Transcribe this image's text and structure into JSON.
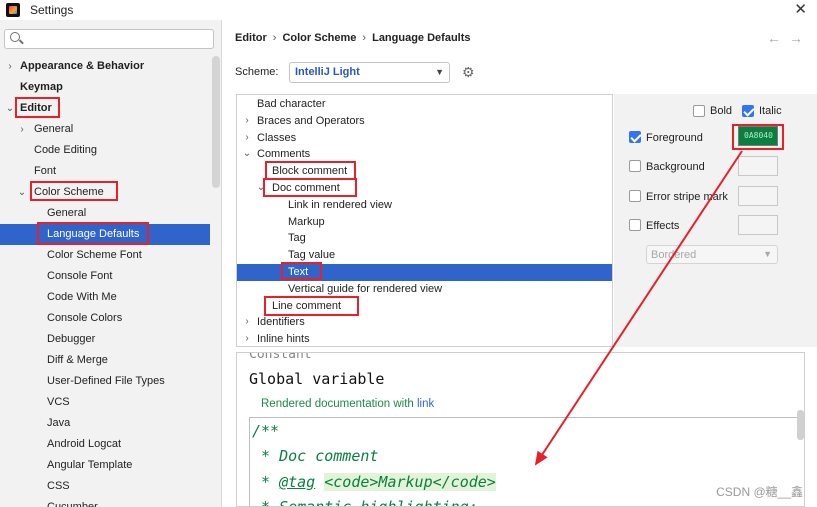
{
  "window": {
    "title": "Settings",
    "close_glyph": "✕"
  },
  "search": {
    "placeholder": "",
    "value": ""
  },
  "sidebar": {
    "items": [
      {
        "label": "Appearance & Behavior",
        "arrow": "›"
      },
      {
        "label": "Keymap",
        "arrow": ""
      },
      {
        "label": "Editor",
        "arrow": "⌄"
      },
      {
        "label": "General",
        "arrow": "›"
      },
      {
        "label": "Code Editing",
        "arrow": ""
      },
      {
        "label": "Font",
        "arrow": ""
      },
      {
        "label": "Color Scheme",
        "arrow": "⌄"
      },
      {
        "label": "General",
        "arrow": ""
      },
      {
        "label": "Language Defaults",
        "arrow": ""
      },
      {
        "label": "Color Scheme Font",
        "arrow": ""
      },
      {
        "label": "Console Font",
        "arrow": ""
      },
      {
        "label": "Code With Me",
        "arrow": ""
      },
      {
        "label": "Console Colors",
        "arrow": ""
      },
      {
        "label": "Debugger",
        "arrow": ""
      },
      {
        "label": "Diff & Merge",
        "arrow": ""
      },
      {
        "label": "User-Defined File Types",
        "arrow": ""
      },
      {
        "label": "VCS",
        "arrow": ""
      },
      {
        "label": "Java",
        "arrow": ""
      },
      {
        "label": "Android Logcat",
        "arrow": ""
      },
      {
        "label": "Angular Template",
        "arrow": ""
      },
      {
        "label": "CSS",
        "arrow": ""
      },
      {
        "label": "Cucumber",
        "arrow": ""
      }
    ]
  },
  "breadcrumb": {
    "part1": "Editor",
    "part2": "Color Scheme",
    "part3": "Language Defaults",
    "sep": "›",
    "back": "←",
    "forward": "→"
  },
  "scheme": {
    "label": "Scheme:",
    "value": "IntelliJ Light",
    "caret": "▼",
    "gear": "⚙"
  },
  "categories": [
    {
      "label": "Bad character",
      "arrow": ""
    },
    {
      "label": "Braces and Operators",
      "arrow": "›"
    },
    {
      "label": "Classes",
      "arrow": "›"
    },
    {
      "label": "Comments",
      "arrow": "⌄"
    },
    {
      "label": "Block comment",
      "arrow": ""
    },
    {
      "label": "Doc comment",
      "arrow": "⌄"
    },
    {
      "label": "Link in rendered view",
      "arrow": ""
    },
    {
      "label": "Markup",
      "arrow": ""
    },
    {
      "label": "Tag",
      "arrow": ""
    },
    {
      "label": "Tag value",
      "arrow": ""
    },
    {
      "label": "Text",
      "arrow": ""
    },
    {
      "label": "Vertical guide for rendered view",
      "arrow": ""
    },
    {
      "label": "Line comment",
      "arrow": ""
    },
    {
      "label": "Identifiers",
      "arrow": "›"
    },
    {
      "label": "Inline hints",
      "arrow": "›"
    }
  ],
  "properties": {
    "bold": {
      "label": "Bold",
      "checked": false
    },
    "italic": {
      "label": "Italic",
      "checked": true
    },
    "foreground": {
      "label": "Foreground",
      "checked": true,
      "color_text": "0A8040",
      "color": "#0A8040"
    },
    "background": {
      "label": "Background",
      "checked": false
    },
    "error_stripe": {
      "label": "Error stripe mark",
      "checked": false
    },
    "effects": {
      "label": "Effects",
      "checked": false,
      "effect_value": "Bordered"
    }
  },
  "preview": {
    "clipped_line": "Constant",
    "global_variable": "Global variable",
    "rendered_text": "Rendered documentation with ",
    "rendered_link": "link",
    "code_line1": "/**",
    "code_line2": " * Doc comment",
    "code_line3_a": " * ",
    "code_line3_tag": "@tag",
    "code_line3_b": " ",
    "code_line3_hl": "<code>Markup</code>",
    "code_line4": " * Semantic highlighting:"
  },
  "watermark": "CSDN @糖__鑫",
  "colors": {
    "selection": "#2F65CA",
    "annotation_red": "#E8202A",
    "doc_green": "#0A8040",
    "accent_blue": "#3574F0"
  }
}
